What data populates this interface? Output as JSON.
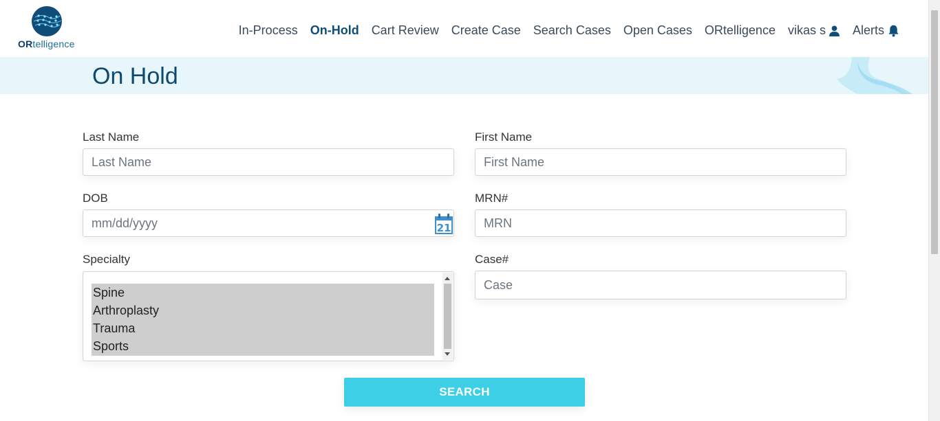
{
  "brand": {
    "logo_prefix": "OR",
    "logo_suffix": "telligence",
    "logo_color": "#1a6e96"
  },
  "nav": {
    "items": [
      {
        "label": "In-Process",
        "active": false
      },
      {
        "label": "On-Hold",
        "active": true
      },
      {
        "label": "Cart Review",
        "active": false
      },
      {
        "label": "Create Case",
        "active": false
      },
      {
        "label": "Search Cases",
        "active": false
      },
      {
        "label": "Open Cases",
        "active": false
      },
      {
        "label": "ORtelligence",
        "active": false
      }
    ],
    "user": {
      "label": "vikas s",
      "icon": "user-icon"
    },
    "alerts": {
      "label": "Alerts",
      "icon": "bell-icon"
    }
  },
  "page": {
    "title": "On Hold",
    "band_color": "#e6f6fb"
  },
  "form": {
    "last_name": {
      "label": "Last Name",
      "placeholder": "Last Name"
    },
    "first_name": {
      "label": "First Name",
      "placeholder": "First Name"
    },
    "dob": {
      "label": "DOB",
      "placeholder": "mm/dd/yyyy",
      "calendar_day": "21",
      "icon": "calendar-icon"
    },
    "mrn": {
      "label": "MRN#",
      "placeholder": "MRN"
    },
    "specialty": {
      "label": "Specialty",
      "options": [
        "Spine",
        "Arthroplasty",
        "Trauma",
        "Sports"
      ]
    },
    "case": {
      "label": "Case#",
      "placeholder": "Case"
    },
    "search_label": "SEARCH",
    "accent": "#3ccfe6"
  }
}
